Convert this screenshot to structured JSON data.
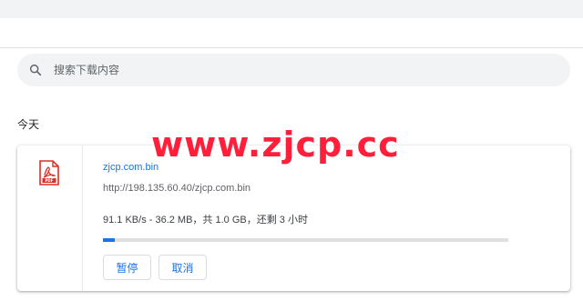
{
  "search": {
    "placeholder": "搜索下载内容",
    "icon": "search-icon"
  },
  "section": {
    "title": "今天"
  },
  "download": {
    "file_icon": "pdf-file-icon",
    "file_name": "zjcp.com.bin",
    "url": "http://198.135.60.40/zjcp.com.bin",
    "status": "91.1 KB/s - 36.2 MB，共 1.0 GB，还剩 3 小时",
    "progress_fraction": 0.03,
    "pause_label": "暂停",
    "cancel_label": "取消"
  },
  "watermark": {
    "text": "www.zjcp.cc"
  },
  "colors": {
    "accent": "#1a73e8",
    "watermark": "#ff1f3a",
    "pdf_icon": "#d93025"
  }
}
